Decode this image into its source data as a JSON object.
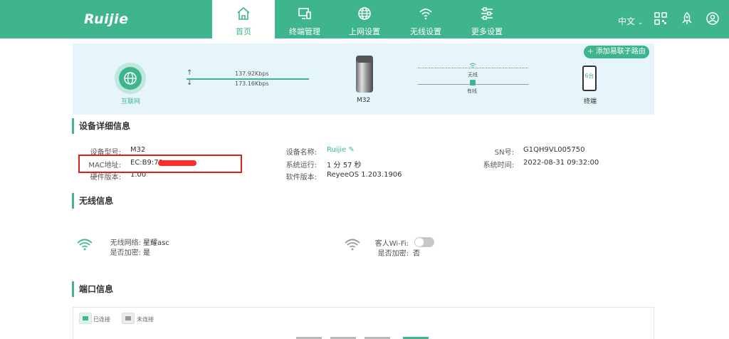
{
  "brand": {
    "logo_text": "Ruijie",
    "accent": "#3fb58f"
  },
  "nav": {
    "tabs": [
      {
        "label": "首页",
        "icon": "home-icon",
        "active": true
      },
      {
        "label": "终端管理",
        "icon": "devices-icon",
        "active": false
      },
      {
        "label": "上网设置",
        "icon": "globe-icon",
        "active": false
      },
      {
        "label": "无线设置",
        "icon": "wifi-icon",
        "active": false
      },
      {
        "label": "更多设置",
        "icon": "sliders-icon",
        "active": false
      }
    ],
    "language": "中文",
    "right_icons": [
      "qrcode-icon",
      "rocket-icon",
      "user-icon"
    ]
  },
  "overview": {
    "internet_label": "互联网",
    "upload_speed": "137.92Kbps",
    "download_speed": "173.16Kbps",
    "device_name": "M32",
    "wireless_label": "无线",
    "wired_label": "有线",
    "clients_count": "6台",
    "clients_label": "终端",
    "add_router_label": "+ 添加易联子路由"
  },
  "device_details": {
    "title": "设备详细信息",
    "model_label": "设备型号:",
    "model_value": "M32",
    "mac_label": "MAC地址:",
    "mac_value": "EC:B9:70:",
    "hw_label": "硬件版本:",
    "hw_value": "1.00",
    "name_label": "设备名称:",
    "name_value": "Ruijie",
    "uptime_label": "系统运行:",
    "uptime_value": "1 分 57 秒",
    "sw_label": "软件版本:",
    "sw_value": "ReyeeOS 1.203.1906",
    "sn_label": "SN号:",
    "sn_value": "G1QH9VL005750",
    "time_label": "系统时间:",
    "time_value": "2022-08-31 09:32:00"
  },
  "wireless": {
    "title": "无线信息",
    "ssid_label": "无线网络:",
    "ssid_value": "星耀asc",
    "enc_label": "是否加密:",
    "enc_value": "是",
    "guest_label": "客人Wi-Fi:",
    "guest_enc_label": "是否加密:",
    "guest_enc_value": "否"
  },
  "ports": {
    "title": "端口信息",
    "connected_label": "已连接",
    "disconnected_label": "未连接"
  }
}
